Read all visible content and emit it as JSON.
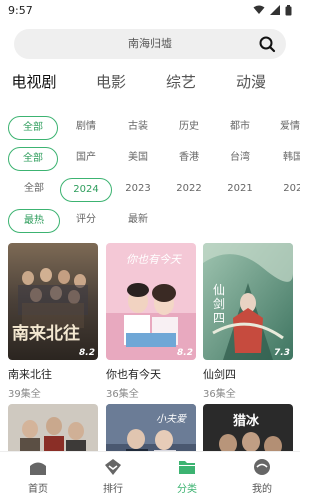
{
  "status": {
    "time": "9:57"
  },
  "search": {
    "placeholder": "南海归墟"
  },
  "tabs": [
    {
      "label": "电视剧",
      "active": true
    },
    {
      "label": "电影",
      "active": false
    },
    {
      "label": "综艺",
      "active": false
    },
    {
      "label": "动漫",
      "active": false
    }
  ],
  "filters": {
    "genre": [
      "全部",
      "剧情",
      "古装",
      "历史",
      "都市",
      "爱情"
    ],
    "region": [
      "全部",
      "国产",
      "美国",
      "香港",
      "台湾",
      "韩国"
    ],
    "year": [
      "全部",
      "2024",
      "2023",
      "2022",
      "2021",
      "2020"
    ],
    "sort": [
      "最热",
      "评分",
      "最新"
    ]
  },
  "cards": [
    {
      "title": "南来北往",
      "sub": "39集全",
      "rating": "8.2",
      "poster_text": "南来北往"
    },
    {
      "title": "你也有今天",
      "sub": "36集全",
      "rating": "8.2",
      "poster_text": "你也有今天"
    },
    {
      "title": "仙剑四",
      "sub": "36集全",
      "rating": "7.3",
      "poster_text": "仙剑四"
    },
    {
      "title": "",
      "sub": "",
      "rating": "",
      "poster_text": ""
    },
    {
      "title": "",
      "sub": "",
      "rating": "",
      "poster_text": "小夫爱"
    },
    {
      "title": "",
      "sub": "",
      "rating": "",
      "poster_text": "猎冰"
    }
  ],
  "nav": [
    {
      "label": "首页",
      "icon": "home-icon",
      "active": false
    },
    {
      "label": "排行",
      "icon": "ranking-icon",
      "active": false
    },
    {
      "label": "分类",
      "icon": "category-folder-icon",
      "active": true
    },
    {
      "label": "我的",
      "icon": "profile-icon",
      "active": false
    }
  ],
  "colors": {
    "accent": "#3cb371",
    "search_bg": "#efefef"
  }
}
